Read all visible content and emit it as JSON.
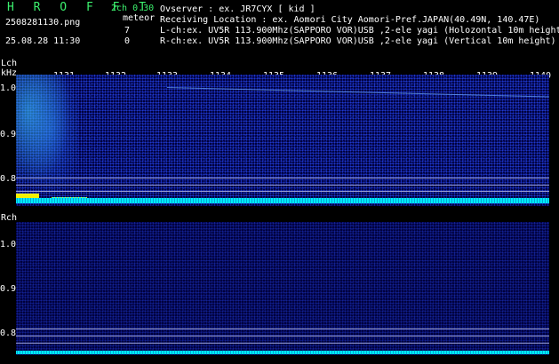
{
  "header": {
    "logo": "H R O F F T",
    "version": "2ch 0.30",
    "filename": "2508281130.png",
    "datetime": "25.08.28 11:30",
    "meteor_label": "meteor",
    "meteor_l_count": "7",
    "meteor_r_count": "0",
    "observer": "Ovserver          : ex. JR7CYX [ kid ]",
    "location": "Receiving Location : ex. Aomori City Aomori-Pref.JAPAN(40.49N, 140.47E)",
    "lch_info": "L-ch:ex. UV5R 113.900Mhz(SAPPORO VOR)USB ,2-ele yagi (Holozontal 10m height)",
    "rch_info": "R-ch:ex. UV5R 113.900Mhz(SAPPORO VOR)USB ,2-ele yagi (Vertical 10m height)"
  },
  "lch": {
    "label": "Lch",
    "unit": "kHz",
    "y_labels": [
      "1.0",
      "0.9",
      "0.8"
    ],
    "time_labels": [
      "1131",
      "1132",
      "1133",
      "1134",
      "1135",
      "1136",
      "1137",
      "1138",
      "1139",
      "1140"
    ]
  },
  "rch": {
    "label": "Rch",
    "y_labels": [
      "1.0",
      "0.9",
      "0.8"
    ]
  }
}
